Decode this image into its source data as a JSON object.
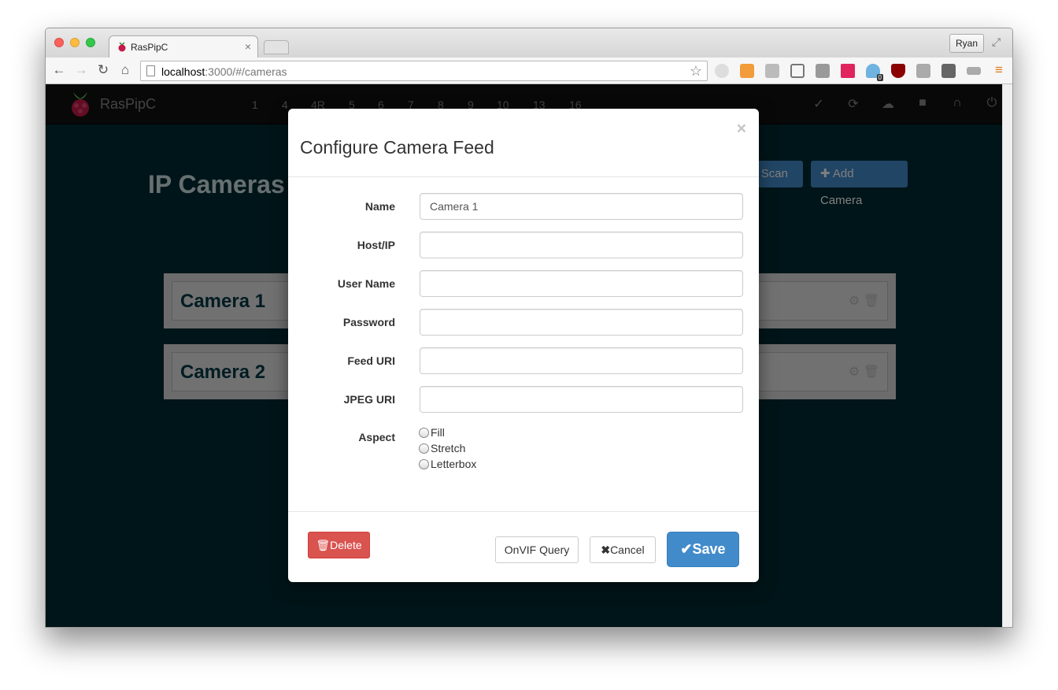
{
  "browser": {
    "tab_title": "RasPipC",
    "tab_close": "×",
    "profile": "Ryan",
    "url_host": "localhost",
    "url_rest": ":3000/#/cameras",
    "extension_badge": "0"
  },
  "navbar": {
    "brand": "RasPipC",
    "numbers": [
      "1",
      "4",
      "4R",
      "5",
      "6",
      "7",
      "8",
      "9",
      "10",
      "13",
      "16"
    ]
  },
  "page": {
    "title": "IP Cameras",
    "scan_label": "Scan",
    "add_camera_label": "Add Camera",
    "cameras": [
      "Camera 1",
      "Camera 2"
    ]
  },
  "modal": {
    "title": "Configure Camera Feed",
    "close": "×",
    "fields": {
      "name_label": "Name",
      "name_value": "Camera 1",
      "host_label": "Host/IP",
      "user_label": "User Name",
      "password_label": "Password",
      "feed_label": "Feed URI",
      "jpeg_label": "JPEG URI",
      "aspect_label": "Aspect"
    },
    "aspect_options": [
      "Fill",
      "Stretch",
      "Letterbox"
    ],
    "buttons": {
      "delete": "Delete",
      "onvif": "OnVIF Query",
      "cancel": "Cancel",
      "save": "Save"
    }
  },
  "colors": {
    "page_bg": "#002a33",
    "primary": "#428bca",
    "danger": "#d9534f"
  }
}
